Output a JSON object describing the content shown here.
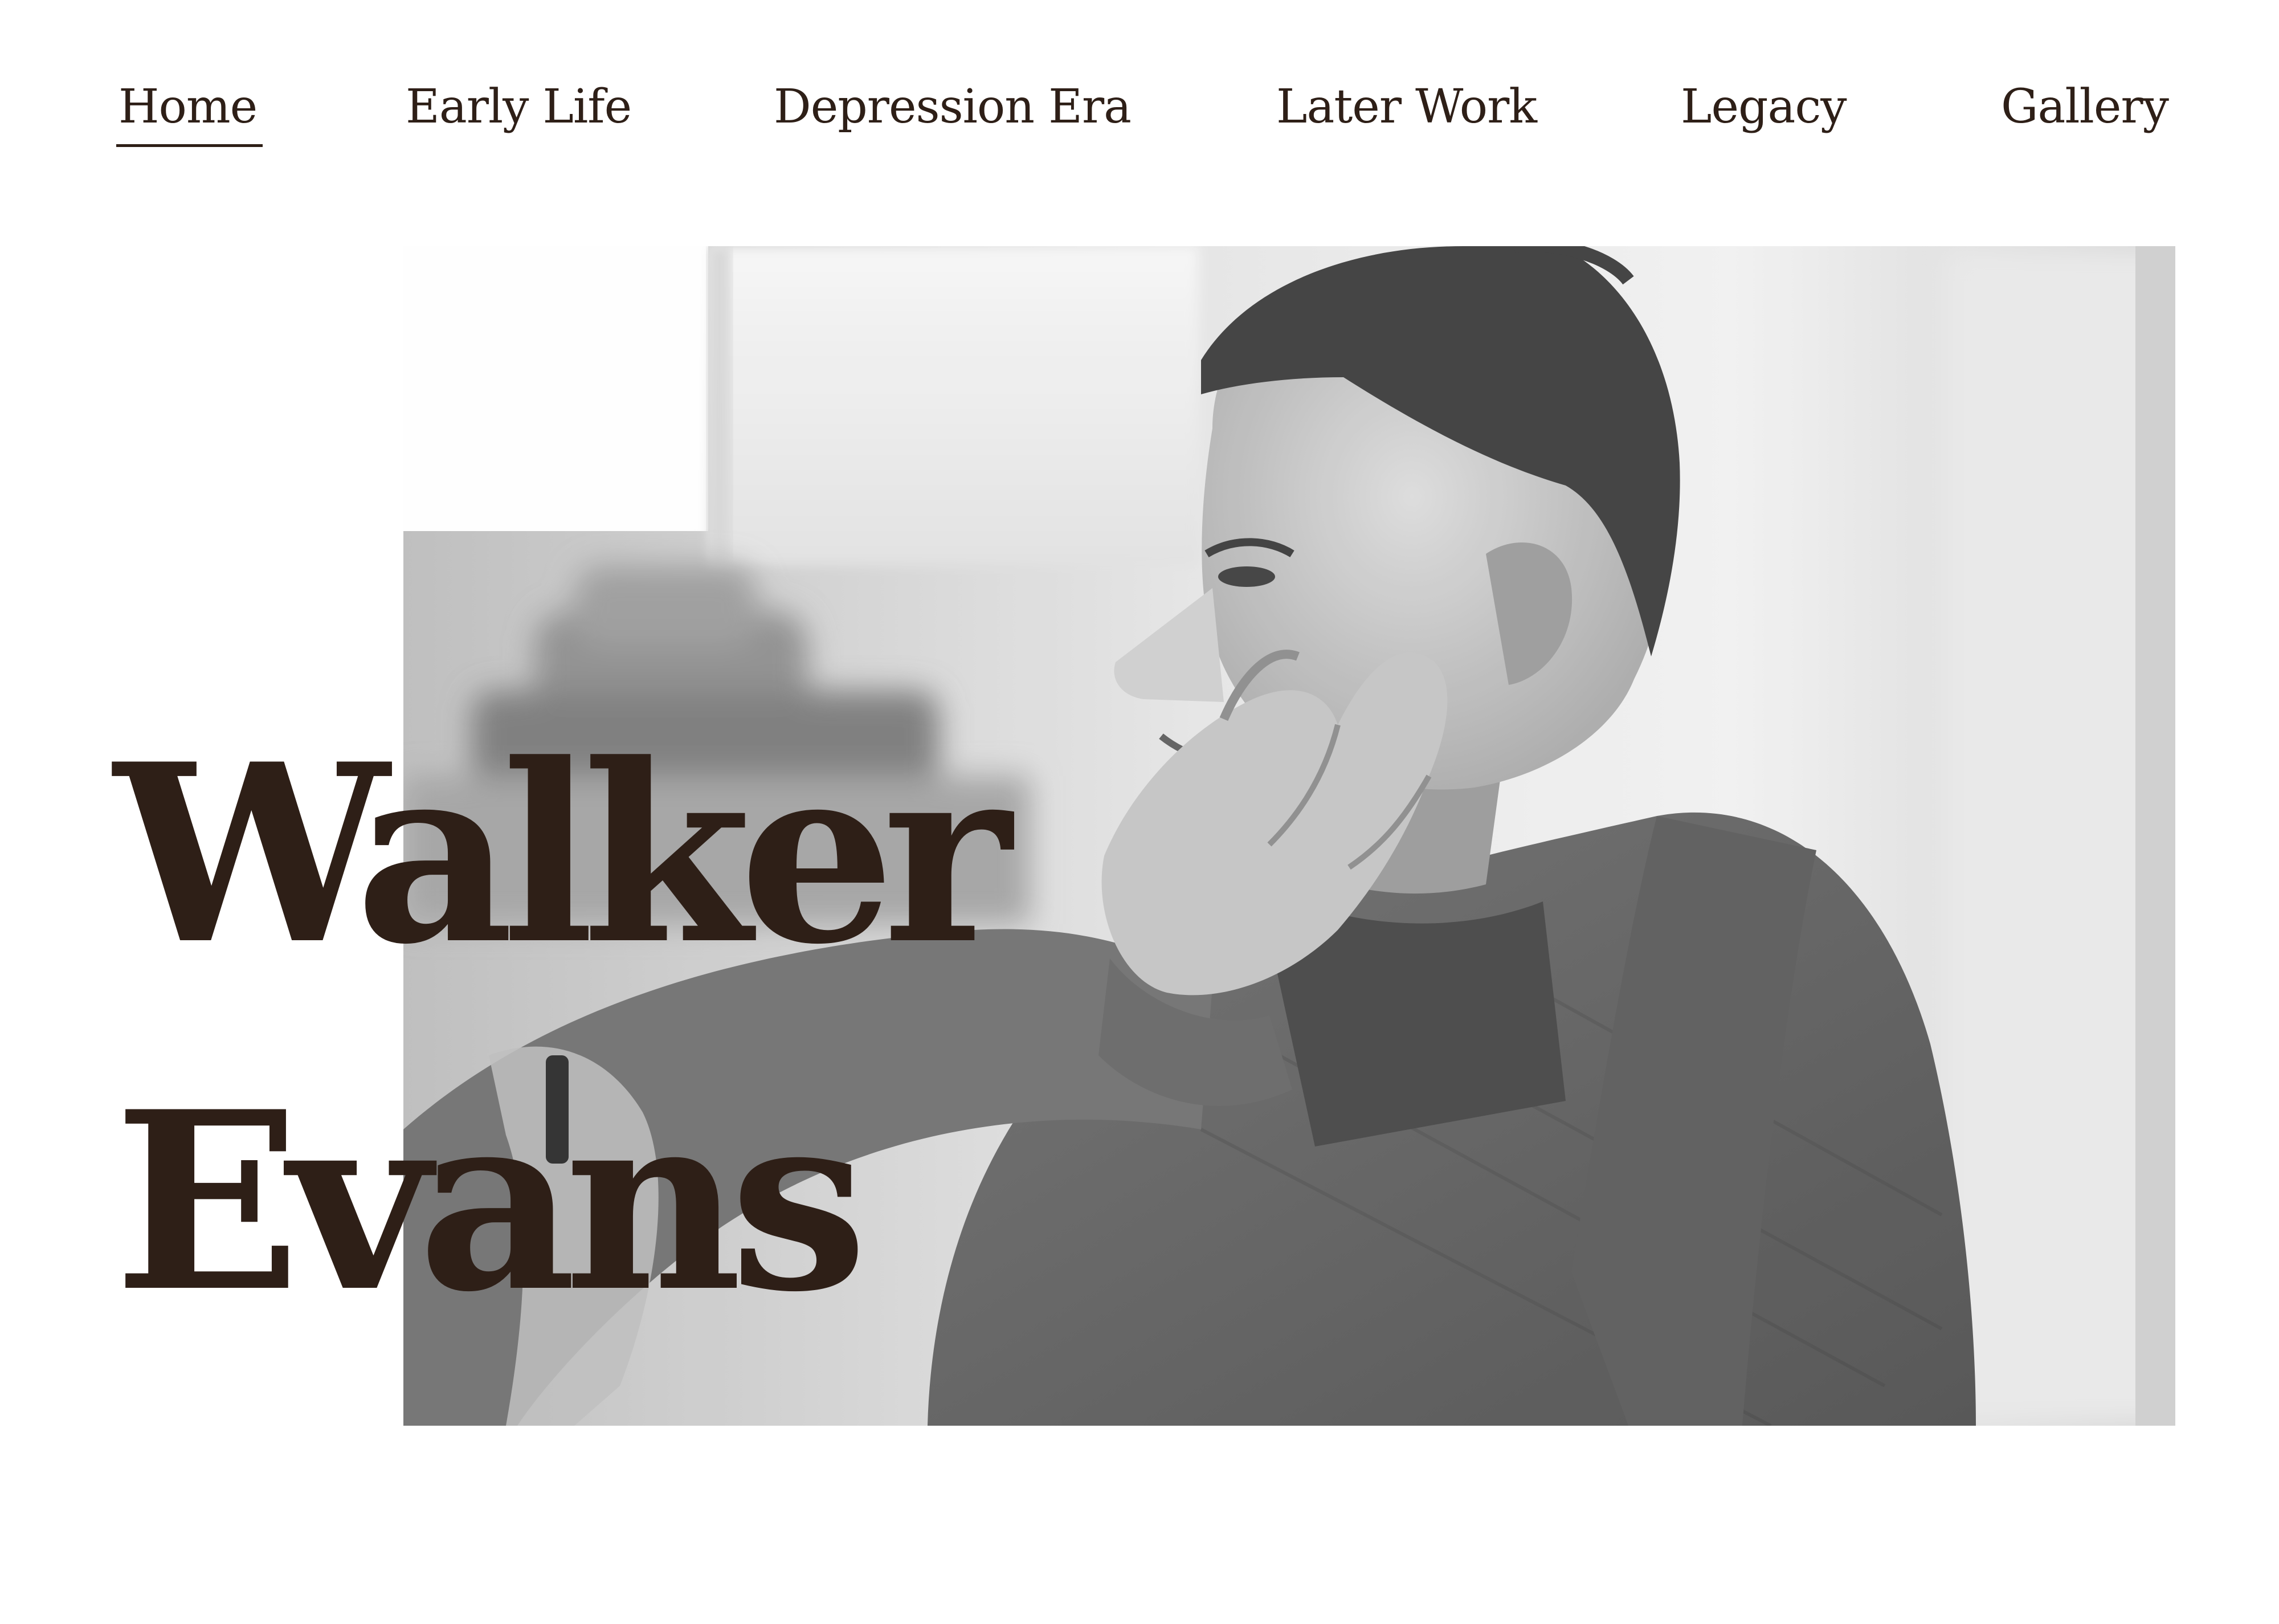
{
  "nav": {
    "items": [
      {
        "label": "Home",
        "active": true
      },
      {
        "label": "Early Life",
        "active": false
      },
      {
        "label": "Depression Era",
        "active": false
      },
      {
        "label": "Later Work",
        "active": false
      },
      {
        "label": "Legacy",
        "active": false
      },
      {
        "label": "Gallery",
        "active": false
      }
    ]
  },
  "hero": {
    "title_line_1": "Walker",
    "title_line_2": "Evans"
  },
  "colors": {
    "text": "#2e1f17",
    "background": "#ffffff",
    "photo_dark": "#5f5f5f",
    "photo_light": "#efefef"
  }
}
